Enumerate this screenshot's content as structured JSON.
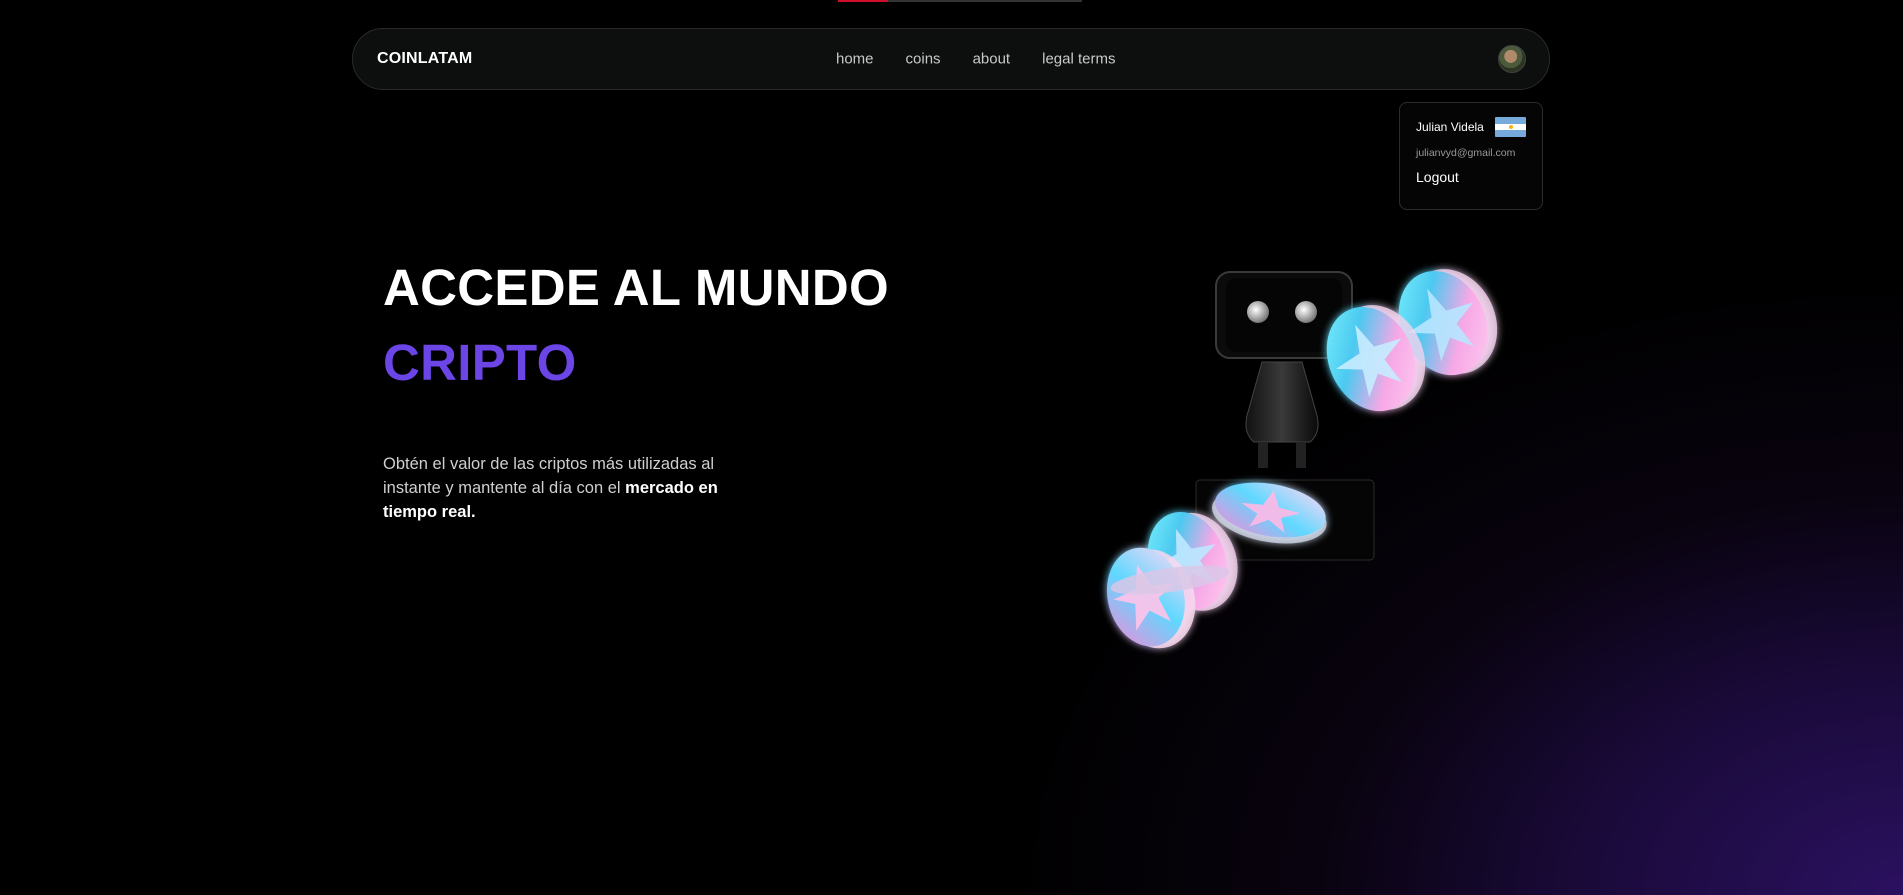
{
  "navbar": {
    "brand": "COINLATAM",
    "links": [
      "home",
      "coins",
      "about",
      "legal terms"
    ]
  },
  "user_menu": {
    "name": "Julian Videla",
    "email": "julianvyd@gmail.com",
    "logout_label": "Logout",
    "country_flag": "argentina-flag"
  },
  "hero": {
    "title": "ACCEDE AL MUNDO",
    "accent": "CRIPTO",
    "description_plain": "Obtén el valor de las criptos más utilizadas al instante y mantente al día con el ",
    "description_bold": "mercado en tiempo real."
  },
  "colors": {
    "accent": "#6b45e6",
    "background": "#000000",
    "glow": "#2b1160"
  },
  "icons": [
    "user-avatar",
    "argentina-flag",
    "robot-coins-illustration"
  ]
}
